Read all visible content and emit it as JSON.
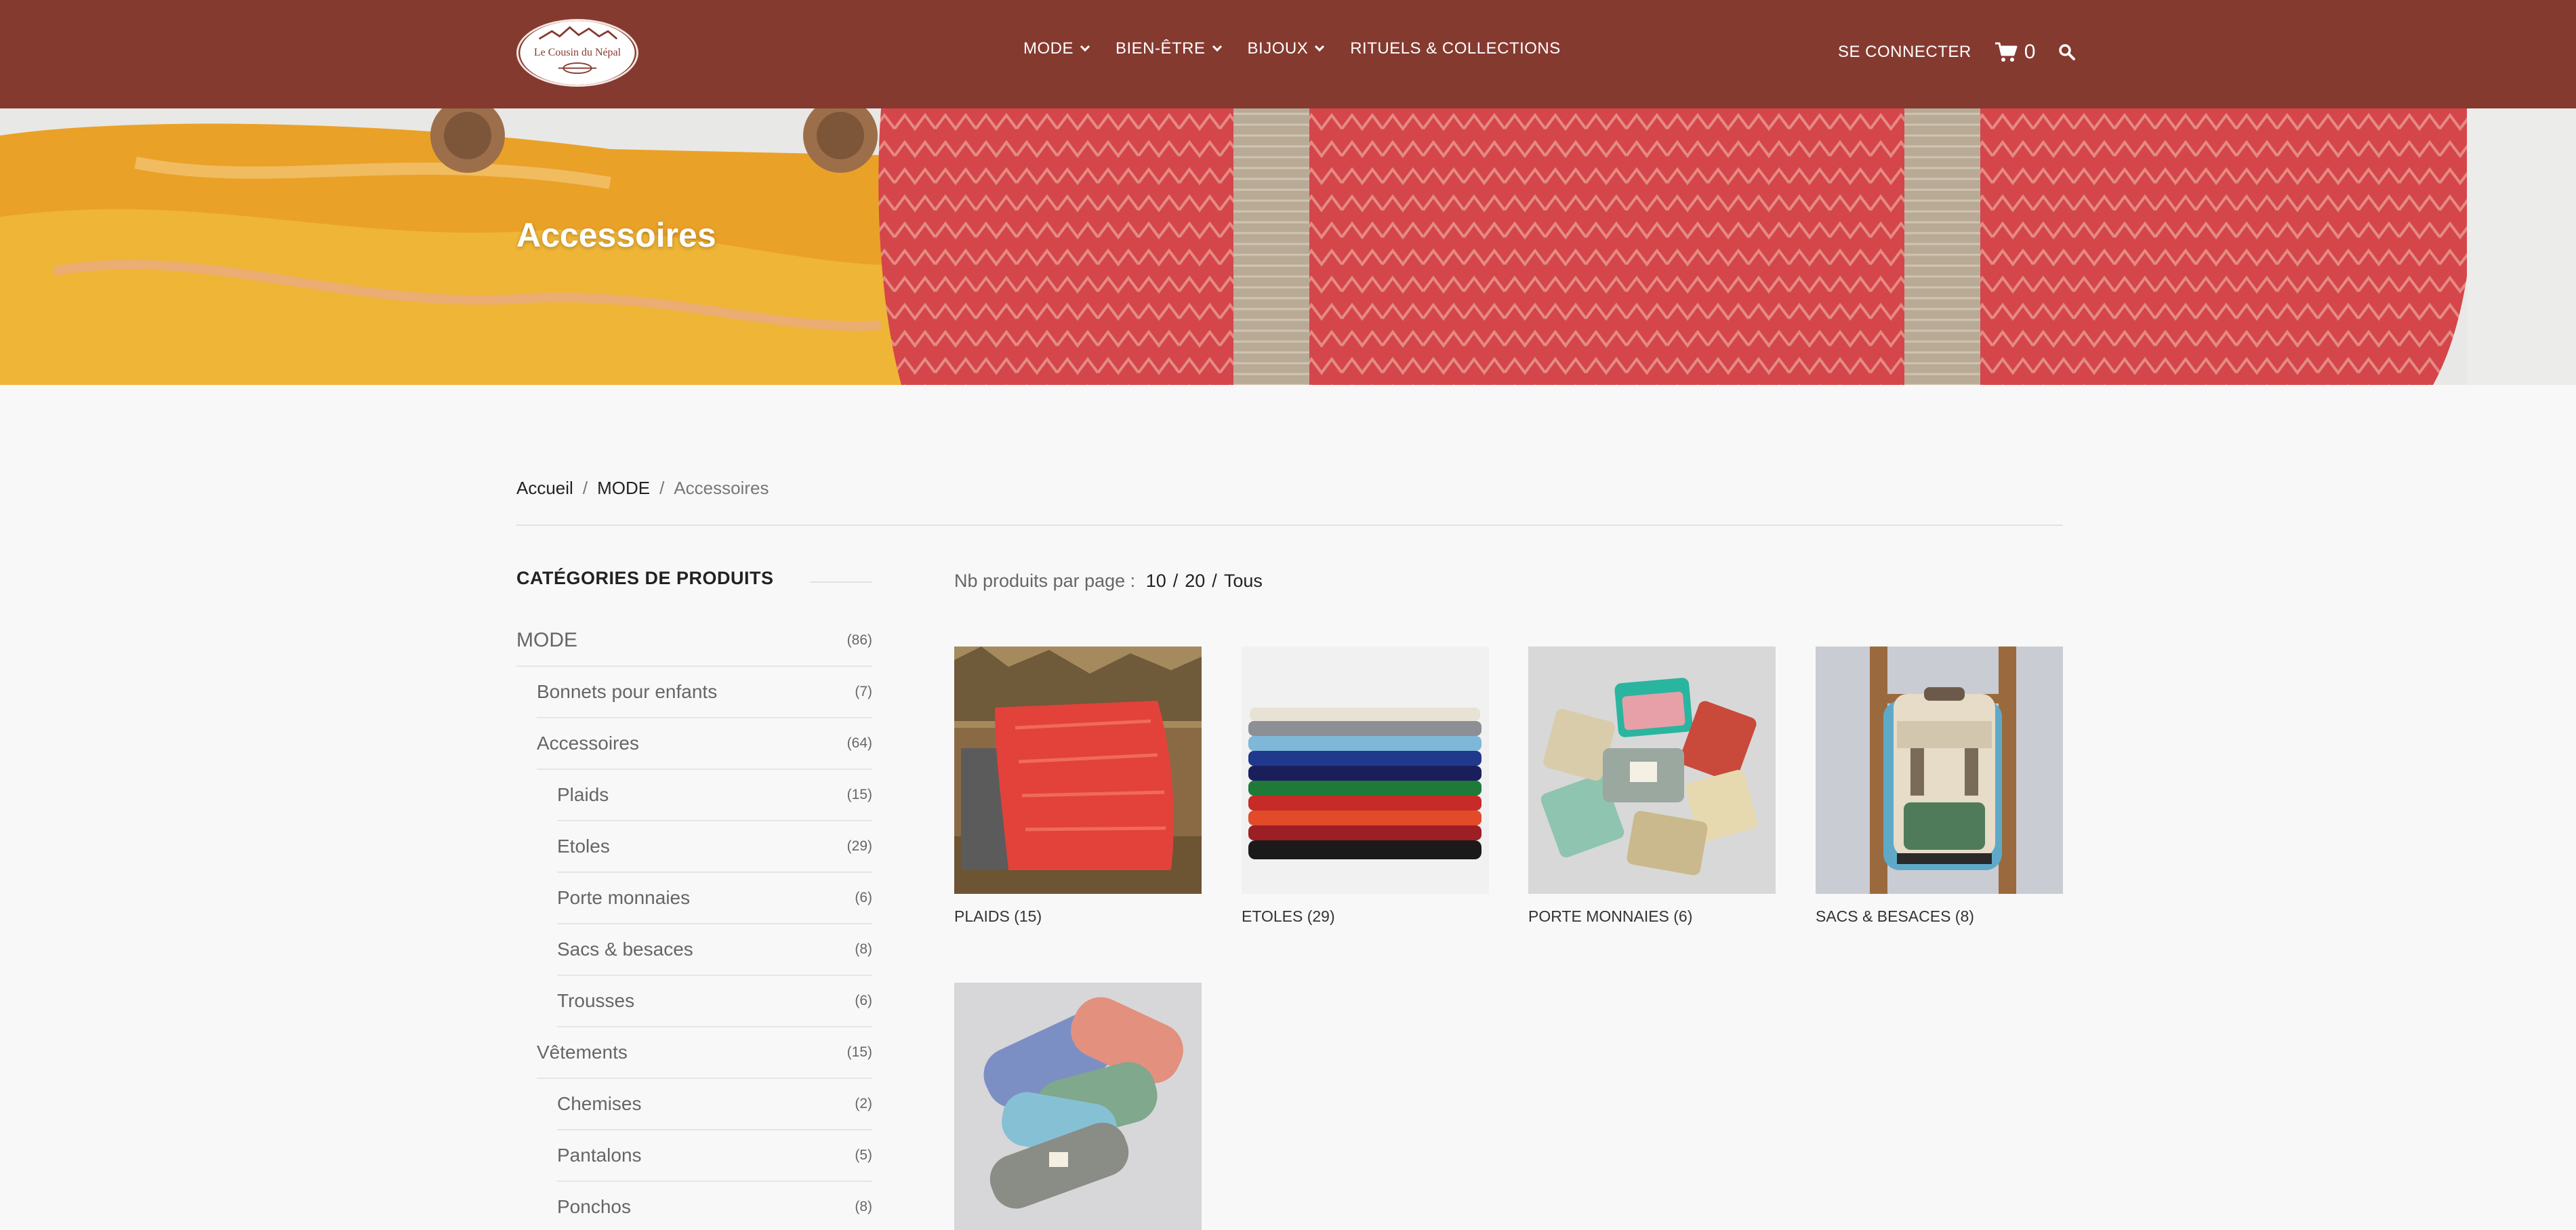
{
  "header": {
    "logo_text": "Le Cousin du Népal",
    "nav": [
      {
        "label": "MODE",
        "has_dropdown": true
      },
      {
        "label": "BIEN-ÊTRE",
        "has_dropdown": true
      },
      {
        "label": "BIJOUX",
        "has_dropdown": true
      },
      {
        "label": "RITUELS & COLLECTIONS",
        "has_dropdown": false
      }
    ],
    "login_label": "SE CONNECTER",
    "cart_count": "0",
    "icons": {
      "cart": "cart-icon",
      "search": "search-icon"
    },
    "background_color": "#853a30"
  },
  "hero": {
    "title": "Accessoires"
  },
  "breadcrumb": {
    "items": [
      "Accueil",
      "MODE",
      "Accessoires"
    ],
    "separator": "/"
  },
  "sidebar": {
    "title": "CATÉGORIES DE PRODUITS",
    "categories": [
      {
        "name": "MODE",
        "count": "(86)",
        "level": 0
      },
      {
        "name": "Bonnets pour enfants",
        "count": "(7)",
        "level": 1
      },
      {
        "name": "Accessoires",
        "count": "(64)",
        "level": 1
      },
      {
        "name": "Plaids",
        "count": "(15)",
        "level": 2
      },
      {
        "name": "Etoles",
        "count": "(29)",
        "level": 2
      },
      {
        "name": "Porte monnaies",
        "count": "(6)",
        "level": 2
      },
      {
        "name": "Sacs & besaces",
        "count": "(8)",
        "level": 2
      },
      {
        "name": "Trousses",
        "count": "(6)",
        "level": 2
      },
      {
        "name": "Vêtements",
        "count": "(15)",
        "level": 1
      },
      {
        "name": "Chemises",
        "count": "(2)",
        "level": 2
      },
      {
        "name": "Pantalons",
        "count": "(5)",
        "level": 2
      },
      {
        "name": "Ponchos",
        "count": "(8)",
        "level": 2
      }
    ]
  },
  "products_per_page": {
    "label": "Nb produits par page :",
    "options": [
      "10",
      "20",
      "Tous"
    ]
  },
  "products": [
    {
      "label": "PLAIDS (15)",
      "image": "red-plaid-on-bench"
    },
    {
      "label": "ETOLES (29)",
      "image": "stack-of-colored-stoles"
    },
    {
      "label": "PORTE MONNAIES (6)",
      "image": "coin-purses-circle"
    },
    {
      "label": "SACS & BESACES (8)",
      "image": "backpack-on-ladder"
    },
    {
      "label": "",
      "image": "pencil-cases"
    }
  ]
}
